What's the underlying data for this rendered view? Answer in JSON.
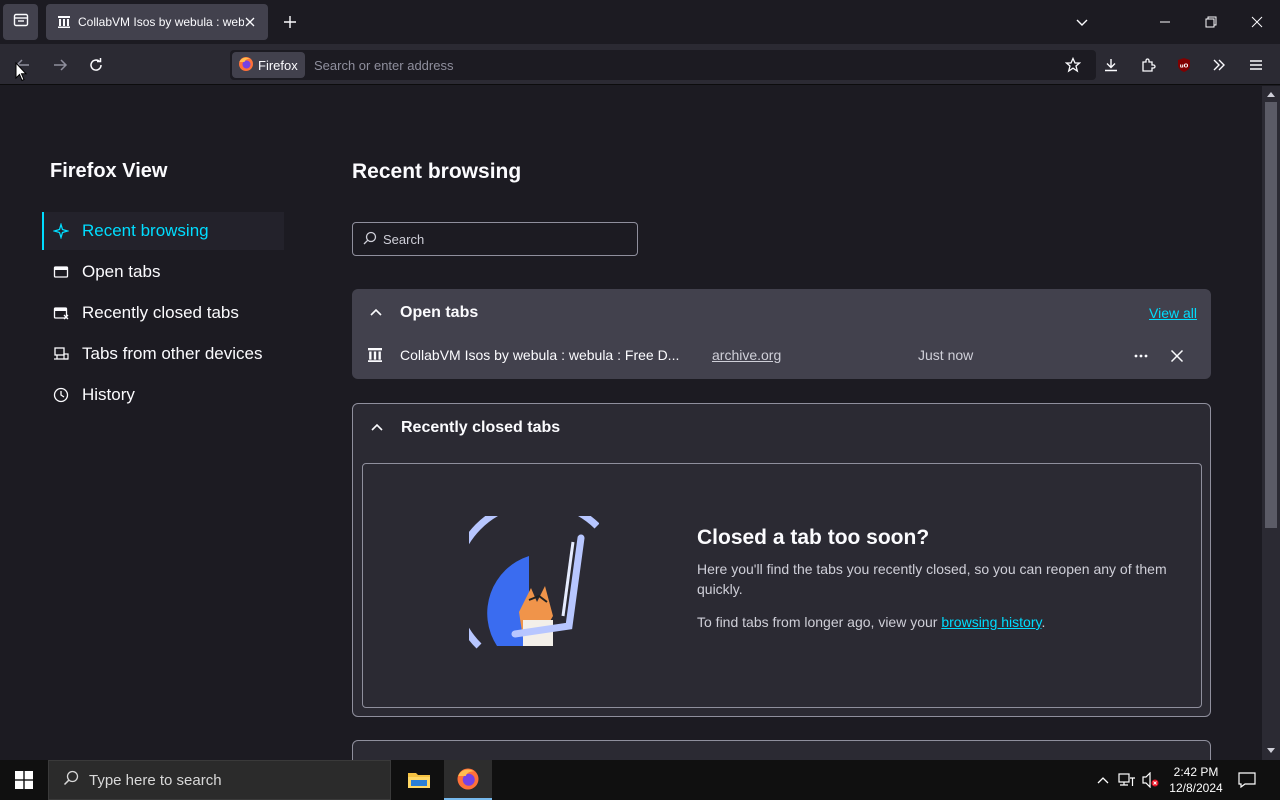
{
  "tabbar": {
    "tab_title": "CollabVM Isos by webula : webula : Free Download",
    "new_tab_tooltip": "+"
  },
  "toolbar": {
    "identity_label": "Firefox",
    "url_placeholder": "Search or enter address"
  },
  "sidebar": {
    "title": "Firefox View",
    "items": [
      {
        "label": "Recent browsing",
        "icon": "sparkle-icon",
        "active": true
      },
      {
        "label": "Open tabs",
        "icon": "window-icon"
      },
      {
        "label": "Recently closed tabs",
        "icon": "closed-tab-icon"
      },
      {
        "label": "Tabs from other devices",
        "icon": "sync-devices-icon"
      },
      {
        "label": "History",
        "icon": "clock-icon"
      }
    ]
  },
  "main": {
    "title": "Recent browsing",
    "search_placeholder": "Search",
    "open_tabs": {
      "heading": "Open tabs",
      "view_all": "View all",
      "row": {
        "title": "CollabVM Isos by webula : webula : Free D...",
        "domain": "archive.org",
        "time": "Just now"
      }
    },
    "recently_closed": {
      "heading": "Recently closed tabs",
      "empty_heading": "Closed a tab too soon?",
      "empty_desc": "Here you'll find the tabs you recently closed, so you can reopen any of them quickly.",
      "hint_prefix": "To find tabs from longer ago, view your ",
      "hint_link": "browsing history",
      "hint_suffix": "."
    }
  },
  "taskbar": {
    "search_placeholder": "Type here to search",
    "time": "2:42 PM",
    "date": "12/8/2024"
  },
  "colors": {
    "accent": "#00ddff",
    "content_bg": "#1c1b22",
    "card_bg": "#42414d",
    "toolbar_bg": "#2b2a33"
  }
}
